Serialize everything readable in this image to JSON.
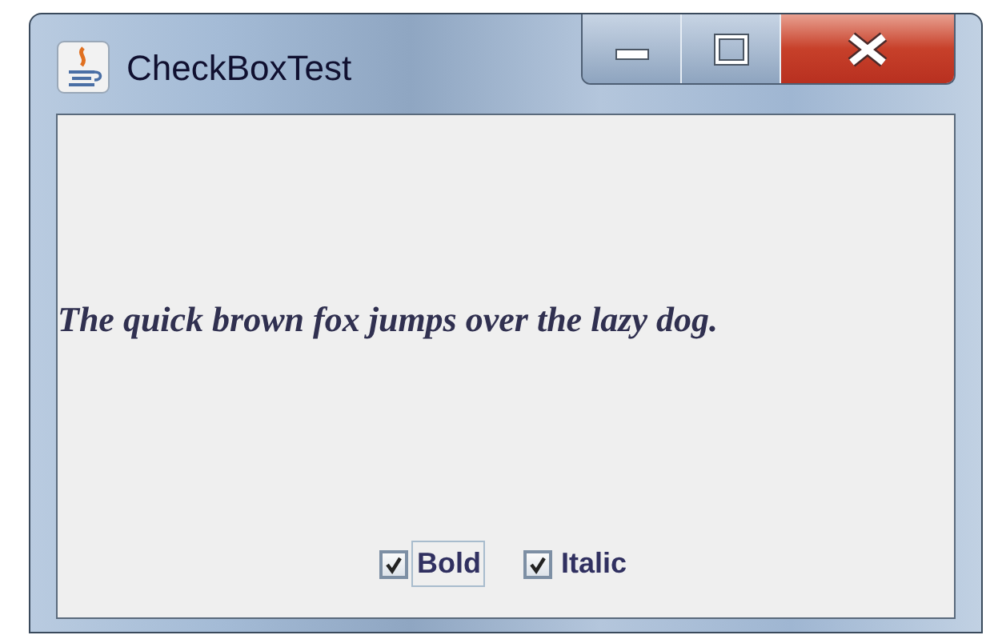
{
  "window": {
    "title": "CheckBoxTest"
  },
  "sample_text": "The quick brown fox jumps over the lazy dog.",
  "checkboxes": [
    {
      "label": "Bold",
      "checked": true,
      "focused": true
    },
    {
      "label": "Italic",
      "checked": true,
      "focused": false
    }
  ]
}
